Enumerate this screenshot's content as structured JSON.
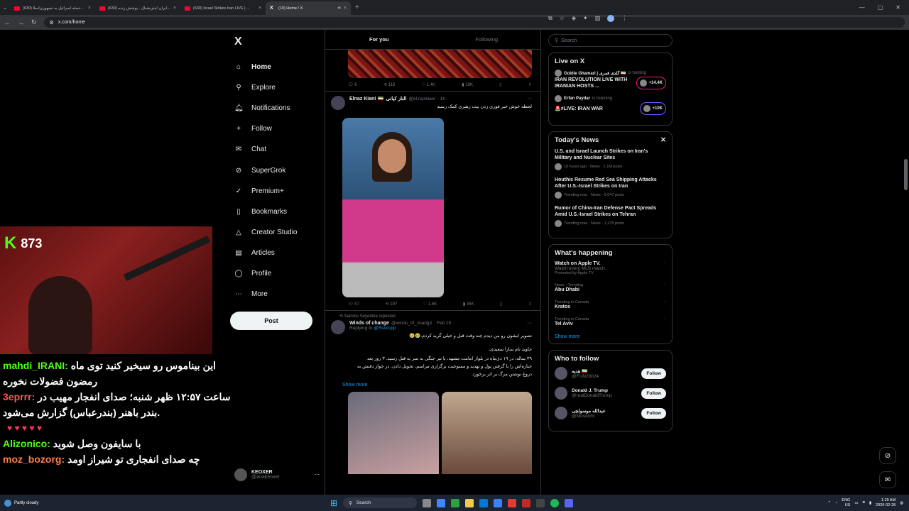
{
  "browser": {
    "tabs": [
      {
        "title": "(630) حمله اسرائیل به جمهوری‌اسلا...",
        "icon": "youtube-icon",
        "active": false
      },
      {
        "title": "(630) ایران اینترنشنال - پوشش زنده...",
        "icon": "youtube-icon",
        "active": false
      },
      {
        "title": "(630) Israel Strikes Iran LIVE | ...",
        "icon": "youtube-icon",
        "active": false
      },
      {
        "title": "(10) Home / X",
        "icon": "x-icon",
        "active": true
      }
    ],
    "url": "x.com/home"
  },
  "stream": {
    "viewer_count": "873",
    "chat": [
      {
        "user": "mahdi_IRANI:",
        "text": "این بیناموس رو سیخیر کنید توی ماه رمضون فضولات نخوره",
        "color": "#53fc18"
      },
      {
        "user": "3eprrr:",
        "text": "ساعت ۱۲:۵۷ ظهر شنبه؛ صدای انفجار مهیب در بندر باهنر (بندرعباس) گزارش می‌شود.",
        "color": "#ff5555"
      },
      {
        "user": "Alizonico:",
        "text": "با سایفون وصل شوید",
        "color": "#53fc18"
      },
      {
        "user": "moz_bozorg:",
        "text": "چه صدای انفجاری تو شیراز اومد",
        "color": "#ff7f50"
      }
    ]
  },
  "sidebar": {
    "logo": "X",
    "items": [
      {
        "label": "Home",
        "icon": "home-icon",
        "glyph": "⌂"
      },
      {
        "label": "Explore",
        "icon": "search-icon",
        "glyph": "⚲"
      },
      {
        "label": "Notifications",
        "icon": "bell-icon",
        "glyph": "🔔︎"
      },
      {
        "label": "Follow",
        "icon": "follow-icon",
        "glyph": "+"
      },
      {
        "label": "Chat",
        "icon": "mail-icon",
        "glyph": "✉"
      },
      {
        "label": "SuperGrok",
        "icon": "grok-icon",
        "glyph": "⊘"
      },
      {
        "label": "Premium+",
        "icon": "premium-icon",
        "glyph": "✓"
      },
      {
        "label": "Bookmarks",
        "icon": "bookmark-icon",
        "glyph": "▯"
      },
      {
        "label": "Creator Studio",
        "icon": "creator-icon",
        "glyph": "△"
      },
      {
        "label": "Articles",
        "icon": "articles-icon",
        "glyph": "▤"
      },
      {
        "label": "Profile",
        "icon": "profile-icon",
        "glyph": "◯"
      },
      {
        "label": "More",
        "icon": "more-icon",
        "glyph": "⋯"
      }
    ],
    "post_label": "Post",
    "account": {
      "name": "KEOXER",
      "handle": "@ariakeoxer"
    }
  },
  "feed": {
    "tabs": [
      "For you",
      "Following"
    ],
    "prev_actions": {
      "replies": "6",
      "reposts": "118",
      "likes": "1.4K",
      "views": "19K"
    },
    "tweet1": {
      "name": "Elnaz Kiani",
      "name_fa": "الناز کیانی",
      "handle": "@el.nazkiani",
      "time": "· 1h",
      "text": "لحظه خوش خبر فوری زدن بیت رهبری کمک رسید",
      "actions": {
        "replies": "57",
        "reposts": "197",
        "likes": "1.6K",
        "views": "35K"
      }
    },
    "tweet2": {
      "repost_by": "Salome Seyednia reposted",
      "name": "Winds of change",
      "handle": "@winds_of_chang3",
      "time": "· Feb 25",
      "reply_prefix": "Replying to",
      "reply_to": "@Sssccpp",
      "text1": "تصویر ایشون رو من دیدم چند وقت قبل و خیلی گریه کردم.😢😢",
      "text2": "جاوید نام سارا سعیدی،",
      "text3": "۳۹ ساله، در ۱۹ دی‌ماه در بلوار امامت مشهد، با تیر جنگی به سر به قتل رسید. ۳ روز بعد جنازه‌اش را با گرفتن پول و تهدید و ممنوعیت برگزاری مراسم، تحویل دادن. در جواز دفنش به دروغ نوشتن مرگ بر اثر برخورد",
      "show_more": "Show more"
    }
  },
  "right": {
    "search_placeholder": "Search",
    "live": {
      "title": "Live on X",
      "items": [
        {
          "host": "Goldie Ghamari | گلدی قمری 🇮🇷",
          "status": "is hosting",
          "title": "IRAN REVOLUTION LIVE WITH IRANIAN HOSTS ...",
          "count": "+14.4K"
        },
        {
          "host": "Erfan Paydar",
          "status": "is listening",
          "title": "🚨#LIVE: IRAN WAR",
          "count": "+10K"
        }
      ]
    },
    "news": {
      "title": "Today's News",
      "items": [
        {
          "headline": "U.S. and Israel Launch Strikes on Iran's Military and Nuclear Sites",
          "meta": "10 hours ago · News · 1.1M posts"
        },
        {
          "headline": "Houthis Resume Red Sea Shipping Attacks After U.S.-Israel Strikes on Iran",
          "meta": "Trending now · News · 5,047 posts"
        },
        {
          "headline": "Rumor of China-Iran Defense Pact Spreads Amid U.S.-Israel Strikes on Tehran",
          "meta": "Trending now · News · 1,276 posts"
        }
      ]
    },
    "happening": {
      "title": "What's happening",
      "items": [
        {
          "context": "",
          "topic": "Watch on Apple TV.",
          "sub": "Watch every MLS match.",
          "promo": "Promoted by Apple TV"
        },
        {
          "context": "News · Trending",
          "topic": "Abu Dhabi"
        },
        {
          "context": "Trending in Canada",
          "topic": "Kratos"
        },
        {
          "context": "Trending in Canada",
          "topic": "Tel Aviv"
        }
      ],
      "show_more": "Show more"
    },
    "follow": {
      "title": "Who to follow",
      "button": "Follow",
      "items": [
        {
          "name": "هدیه 🇮🇷",
          "handle": "@FUN20024"
        },
        {
          "name": "Donald J. Trump",
          "handle": "@realDonaldTrump"
        },
        {
          "name": "عبدالله موسولچی",
          "handle": "@Mosolchi"
        }
      ]
    }
  },
  "taskbar": {
    "weather": "Partly cloudy",
    "search": "Search",
    "lang": "ENG",
    "region": "US",
    "time": "1:29 AM",
    "date": "2026-02-28"
  }
}
